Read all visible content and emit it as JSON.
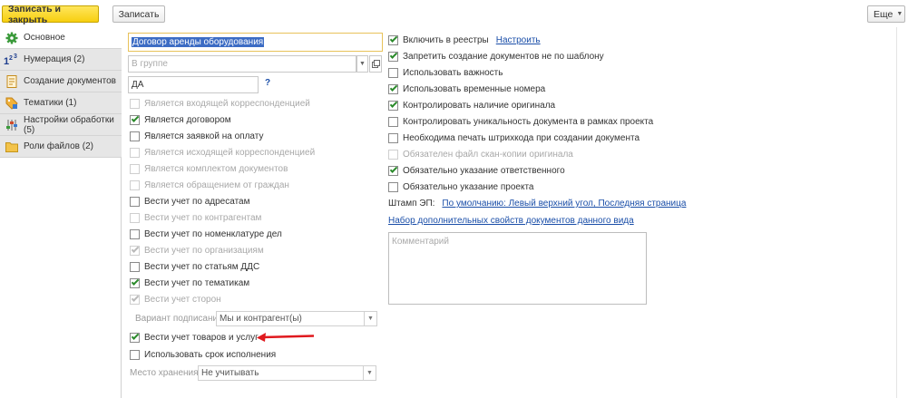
{
  "toolbar": {
    "save_close": "Записать и закрыть",
    "save": "Записать",
    "more": "Еще"
  },
  "sidebar": {
    "items": [
      {
        "label": "Основное",
        "icon": "gear-icon"
      },
      {
        "label": "Нумерация (2)",
        "icon": "numbering-icon"
      },
      {
        "label": "Создание документов",
        "icon": "document-icon"
      },
      {
        "label": "Тематики (1)",
        "icon": "tag-icon"
      },
      {
        "label": "Настройки обработки (5)",
        "icon": "settings-sliders-icon"
      },
      {
        "label": "Роли файлов (2)",
        "icon": "folder-icon"
      }
    ]
  },
  "form": {
    "name_value": "Договор аренды оборудования",
    "group_placeholder": "В группе",
    "code_value": "ДА",
    "help": "?",
    "left_checks": [
      {
        "label": "Является входящей корреспонденцией",
        "checked": false,
        "disabled": true
      },
      {
        "label": "Является договором",
        "checked": true,
        "disabled": false
      },
      {
        "label": "Является заявкой на оплату",
        "checked": false,
        "disabled": false
      },
      {
        "label": "Является исходящей корреспонденцией",
        "checked": false,
        "disabled": true
      },
      {
        "label": "Является комплектом документов",
        "checked": false,
        "disabled": true
      },
      {
        "label": "Является обращением от граждан",
        "checked": false,
        "disabled": true
      },
      {
        "label": "Вести учет по адресатам",
        "checked": false,
        "disabled": false
      },
      {
        "label": "Вести учет по контрагентам",
        "checked": false,
        "disabled": true
      },
      {
        "label": "Вести учет по номенклатуре дел",
        "checked": false,
        "disabled": false
      },
      {
        "label": "Вести учет по организациям",
        "checked": true,
        "disabled": true
      },
      {
        "label": "Вести учет по статьям ДДС",
        "checked": false,
        "disabled": false
      },
      {
        "label": "Вести учет по тематикам",
        "checked": true,
        "disabled": false
      },
      {
        "label": "Вести учет сторон",
        "checked": true,
        "disabled": true
      }
    ],
    "signing_label": "Вариант подписания:",
    "signing_value": "Мы и контрагент(ы)",
    "goods_check": {
      "label": "Вести учет товаров и услуг",
      "checked": true
    },
    "deadline_check": {
      "label": "Использовать срок исполнения",
      "checked": false
    },
    "storage_label": "Место хранения:",
    "storage_value": "Не учитывать",
    "right_checks": [
      {
        "label": "Включить в реестры",
        "checked": true,
        "disabled": false
      },
      {
        "label": "Запретить создание документов не по шаблону",
        "checked": true,
        "disabled": false
      },
      {
        "label": "Использовать важность",
        "checked": false,
        "disabled": false
      },
      {
        "label": "Использовать временные номера",
        "checked": true,
        "disabled": false
      },
      {
        "label": "Контролировать наличие оригинала",
        "checked": true,
        "disabled": false
      },
      {
        "label": "Контролировать уникальность документа в рамках проекта",
        "checked": false,
        "disabled": false
      },
      {
        "label": "Необходима печать штрихкода при создании документа",
        "checked": false,
        "disabled": false
      },
      {
        "label": "Обязателен файл скан-копии оригинала",
        "checked": false,
        "disabled": true
      },
      {
        "label": "Обязательно указание ответственного",
        "checked": true,
        "disabled": false
      },
      {
        "label": "Обязательно указание проекта",
        "checked": false,
        "disabled": false
      }
    ],
    "configure_link": "Настроить",
    "stamp_label": "Штамп ЭП:",
    "stamp_link": "По умолчанию: Левый верхний угол, Последняя страница",
    "props_link": "Набор дополнительных свойств документов данного вида",
    "comment_placeholder": "Комментарий"
  }
}
